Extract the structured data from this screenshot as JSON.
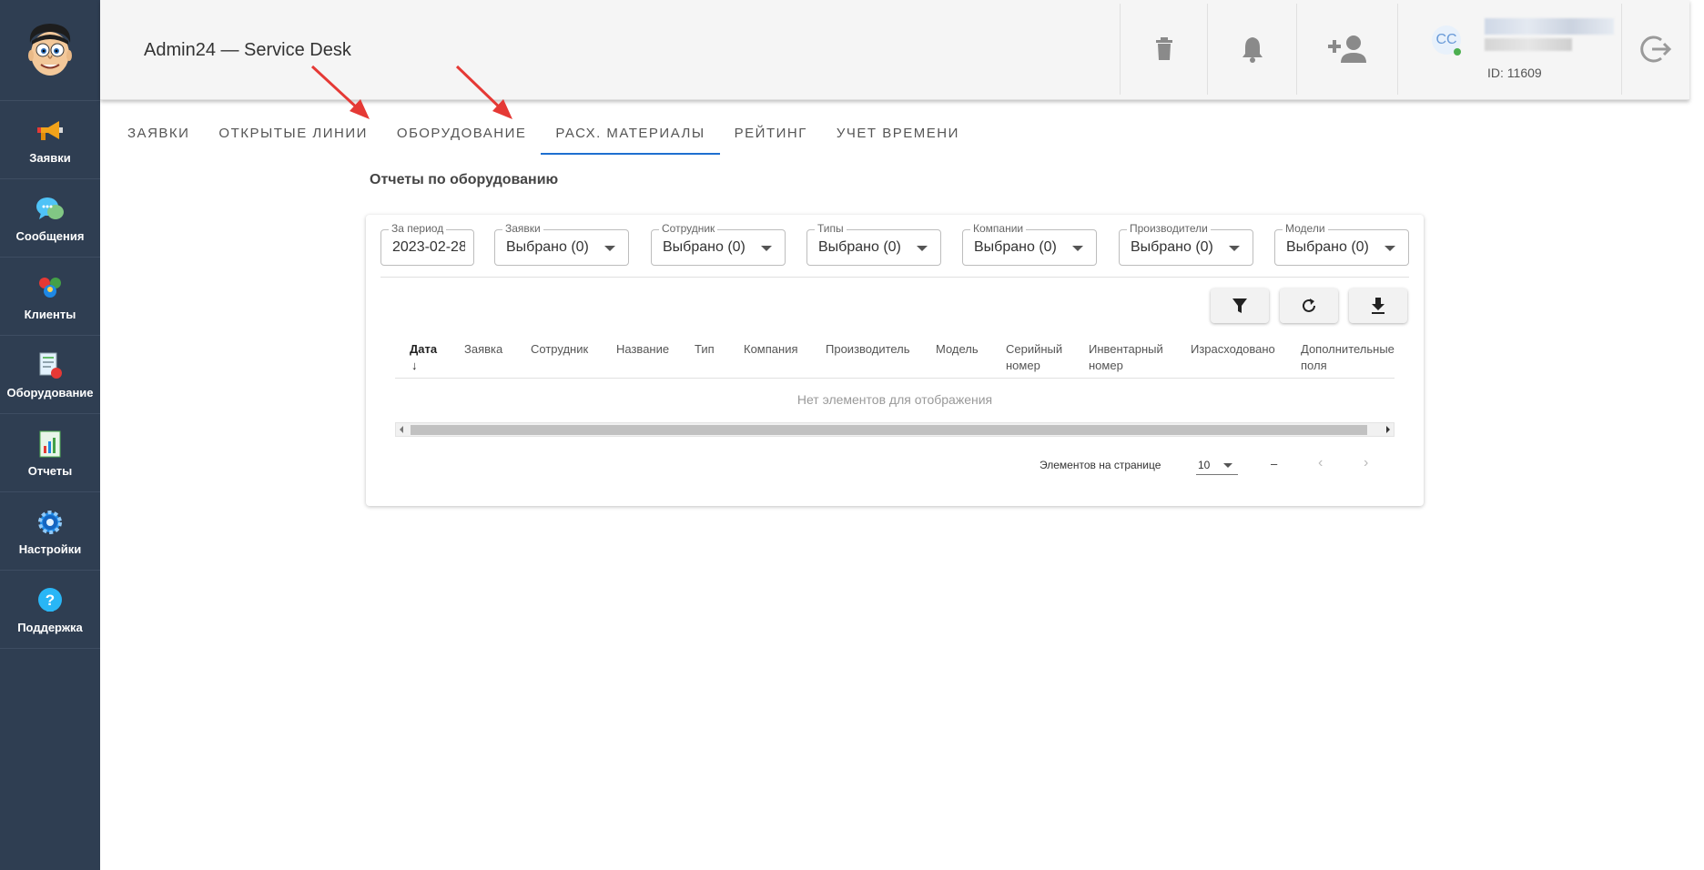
{
  "sidebar": {
    "items": [
      {
        "label": "Заявки",
        "icon": "megaphone-icon"
      },
      {
        "label": "Сообщения",
        "icon": "chat-bubbles-icon"
      },
      {
        "label": "Клиенты",
        "icon": "clients-icon"
      },
      {
        "label": "Оборудование",
        "icon": "equipment-icon"
      },
      {
        "label": "Отчеты",
        "icon": "report-chart-icon"
      },
      {
        "label": "Настройки",
        "icon": "gear-icon"
      },
      {
        "label": "Поддержка",
        "icon": "help-icon"
      }
    ]
  },
  "header": {
    "title": "Admin24 — Service Desk",
    "user": {
      "initials": "CC",
      "id_label": "ID: 11609"
    }
  },
  "tabs": [
    {
      "label": "ЗАЯВКИ",
      "active": false
    },
    {
      "label": "ОТКРЫТЫЕ ЛИНИИ",
      "active": false
    },
    {
      "label": "ОБОРУДОВАНИЕ",
      "active": false
    },
    {
      "label": "РАСХ. МАТЕРИАЛЫ",
      "active": true
    },
    {
      "label": "РЕЙТИНГ",
      "active": false
    },
    {
      "label": "УЧЕТ ВРЕМЕНИ",
      "active": false
    }
  ],
  "section_title": "Отчеты по оборудованию",
  "filters": {
    "period": {
      "label": "За период",
      "value": "2023-02-28"
    },
    "requests": {
      "label": "Заявки",
      "value": "Выбрано (0)"
    },
    "employee": {
      "label": "Сотрудник",
      "value": "Выбрано (0)"
    },
    "types": {
      "label": "Типы",
      "value": "Выбрано (0)"
    },
    "companies": {
      "label": "Компании",
      "value": "Выбрано (0)"
    },
    "manufacturers": {
      "label": "Производители",
      "value": "Выбрано (0)"
    },
    "models": {
      "label": "Модели",
      "value": "Выбрано (0)"
    }
  },
  "table": {
    "columns": [
      {
        "l1": "Дата",
        "l2": "↓"
      },
      {
        "l1": "Заявка",
        "l2": ""
      },
      {
        "l1": "Сотрудник",
        "l2": ""
      },
      {
        "l1": "Название",
        "l2": ""
      },
      {
        "l1": "Тип",
        "l2": ""
      },
      {
        "l1": "Компания",
        "l2": ""
      },
      {
        "l1": "Производитель",
        "l2": ""
      },
      {
        "l1": "Модель",
        "l2": ""
      },
      {
        "l1": "Серийный",
        "l2": "номер"
      },
      {
        "l1": "Инвентарный",
        "l2": "номер"
      },
      {
        "l1": "Израсходовано",
        "l2": ""
      },
      {
        "l1": "Дополнительные",
        "l2": "поля"
      }
    ],
    "empty_message": "Нет элементов для отображения"
  },
  "pagination": {
    "per_page_label": "Элементов на странице",
    "per_page_value": "10",
    "range": "–",
    "prev_icon": "‹",
    "next_icon": "›"
  },
  "colors": {
    "sidebar_bg": "#2f3e52",
    "accent": "#1e6fd0",
    "annotation_arrow": "#e53935"
  }
}
